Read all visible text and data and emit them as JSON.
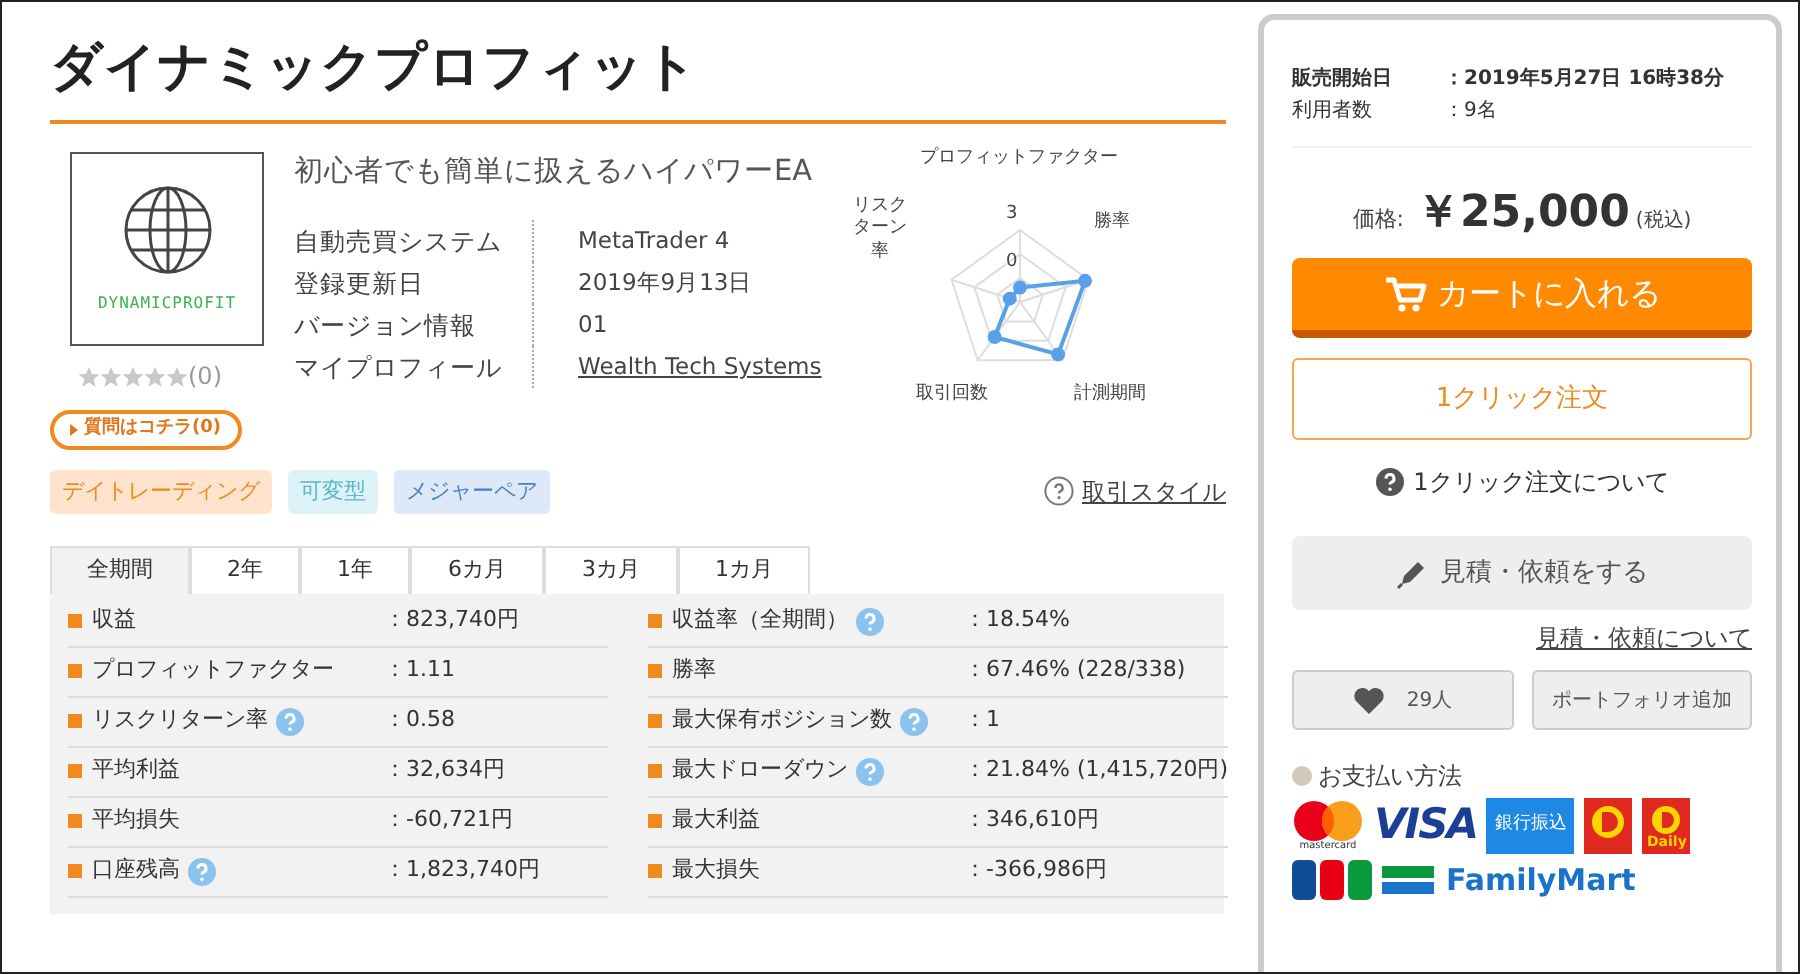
{
  "title": "ダイナミックプロフィット",
  "product": {
    "logo_text": "DYNAMICPROFIT",
    "stars": 0,
    "review_count": "(0)",
    "question_button": "質問はコチラ(0)",
    "catchphrase": "初心者でも簡単に扱えるハイパワーEA",
    "info": [
      {
        "label": "自動売買システム",
        "value": "MetaTrader 4",
        "kind": "text"
      },
      {
        "label": "登録更新日",
        "value": "2019年9月13日",
        "kind": "text"
      },
      {
        "label": "バージョン情報",
        "value": "01",
        "kind": "text"
      },
      {
        "label": "マイプロフィール",
        "value": "Wealth Tech Systems",
        "kind": "link"
      }
    ]
  },
  "radar": {
    "axes": [
      "プロフィットファクター",
      "勝率",
      "計測期間",
      "取引回数",
      "リスクターン率"
    ],
    "tick_labels": [
      "3",
      "0"
    ]
  },
  "tags": [
    {
      "label": "デイトレーディング",
      "color": "#ffe3cc"
    },
    {
      "label": "可変型",
      "color": "#ddf3f7"
    },
    {
      "label": "メジャーペア",
      "color": "#dde8f8"
    }
  ],
  "trade_style_link": "取引スタイル",
  "tabs": [
    {
      "label": "全期間",
      "selected": true
    },
    {
      "label": "2年",
      "selected": false
    },
    {
      "label": "1年",
      "selected": false
    },
    {
      "label": "6カ月",
      "selected": false
    },
    {
      "label": "3カ月",
      "selected": false
    },
    {
      "label": "1カ月",
      "selected": false
    }
  ],
  "stats": [
    {
      "label": "収益",
      "help": false,
      "value": "：823,740円"
    },
    {
      "label": "収益率（全期間）",
      "help": true,
      "value": "：18.54%"
    },
    {
      "label": "プロフィットファクター",
      "help": false,
      "value": "：1.11"
    },
    {
      "label": "勝率",
      "help": false,
      "value": "：67.46% (228/338)"
    },
    {
      "label": "リスクリターン率",
      "help": true,
      "value": "：0.58"
    },
    {
      "label": "最大保有ポジション数",
      "help": true,
      "value": "：1"
    },
    {
      "label": "平均利益",
      "help": false,
      "value": "：32,634円"
    },
    {
      "label": "最大ドローダウン",
      "help": true,
      "value": "：21.84% (1,415,720円)"
    },
    {
      "label": "平均損失",
      "help": false,
      "value": "：-60,721円"
    },
    {
      "label": "最大利益",
      "help": false,
      "value": "：346,610円"
    },
    {
      "label": "口座残高",
      "help": true,
      "value": "：1,823,740円"
    },
    {
      "label": "最大損失",
      "help": false,
      "value": "：-366,986円"
    }
  ],
  "sidebar": {
    "meta": [
      {
        "label": "販売開始日",
        "value": "：2019年5月27日 16時38分",
        "bold": true
      },
      {
        "label": "利用者数",
        "value": "：9名",
        "bold": false
      }
    ],
    "price_label": "価格:",
    "price": "￥25,000",
    "tax_note": "(税込)",
    "cart_button": "カートに入れる",
    "one_click_button": "1クリック注文",
    "one_click_help": "1クリック注文について",
    "quote_button": "見積・依頼をする",
    "quote_link": "見積・依頼について",
    "like_count": "29人",
    "portfolio_button": "ポートフォリオ追加",
    "payment_title": "お支払い方法",
    "payment_logos": [
      {
        "kind": "mastercard",
        "text": "mastercard"
      },
      {
        "kind": "visa",
        "text": "VISA"
      },
      {
        "kind": "bank",
        "text": "銀行振込"
      },
      {
        "kind": "yamazaki"
      },
      {
        "kind": "daily",
        "text": "Daily"
      },
      {
        "kind": "jcb"
      },
      {
        "kind": "familymart",
        "text": "FamilyMart"
      }
    ]
  }
}
